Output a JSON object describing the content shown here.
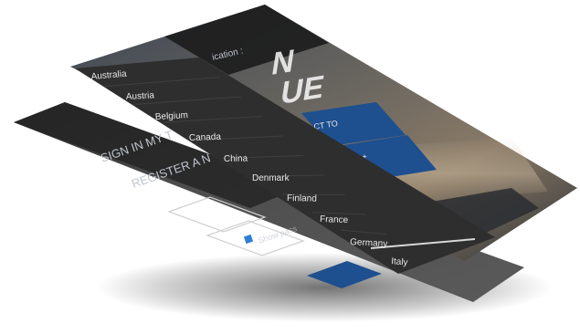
{
  "back_screen": {
    "title": "SIGN IN MY T",
    "register_label": "REGISTER A N",
    "show_password_label": "Show pass"
  },
  "mid_screen": {
    "header_fragment": "ication :",
    "big_text_line1": "N",
    "big_text_line2": "UE",
    "button_1_label": "CT TO",
    "button_2_label": "UE ++"
  },
  "country_dropdown": {
    "items": [
      "Australia",
      "Austria",
      "Belgium",
      "Canada",
      "China",
      "Denmark",
      "Finland",
      "France",
      "Germany",
      "Italy"
    ],
    "selected": "Italy"
  },
  "colors": {
    "list_bg": "#2e2e2e",
    "list_divider": "#3f3f3f",
    "button_blue": "#1e4f8f",
    "selected_underline": "#d8d8d8"
  }
}
